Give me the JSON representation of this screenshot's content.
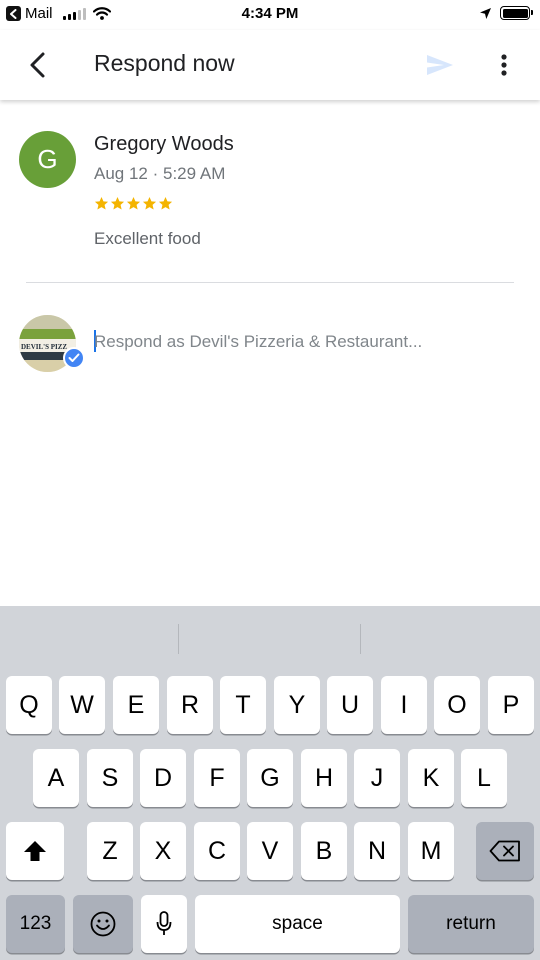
{
  "status_bar": {
    "back_app": "Mail",
    "time": "4:34 PM"
  },
  "app_bar": {
    "title": "Respond now",
    "icons": [
      "back-arrow-icon",
      "send-icon",
      "more-vert-icon"
    ]
  },
  "review": {
    "avatar_letter": "G",
    "avatar_color": "#689f38",
    "reviewer_name": "Gregory Woods",
    "date": "Aug 12 · 5:29 AM",
    "rating": 5,
    "rating_max": 5,
    "star_color": "#f4b400",
    "text": "Excellent food"
  },
  "response": {
    "business_photo_text": "DEVIL'S PIZZ",
    "verified": true,
    "placeholder": "Respond as Devil's Pizzeria & Restaurant...",
    "value": ""
  },
  "keyboard": {
    "row1": [
      "Q",
      "W",
      "E",
      "R",
      "T",
      "Y",
      "U",
      "I",
      "O",
      "P"
    ],
    "row2": [
      "A",
      "S",
      "D",
      "F",
      "G",
      "H",
      "J",
      "K",
      "L"
    ],
    "row3": [
      "Z",
      "X",
      "C",
      "V",
      "B",
      "N",
      "M"
    ],
    "numbers_label": "123",
    "space_label": "space",
    "return_label": "return"
  }
}
